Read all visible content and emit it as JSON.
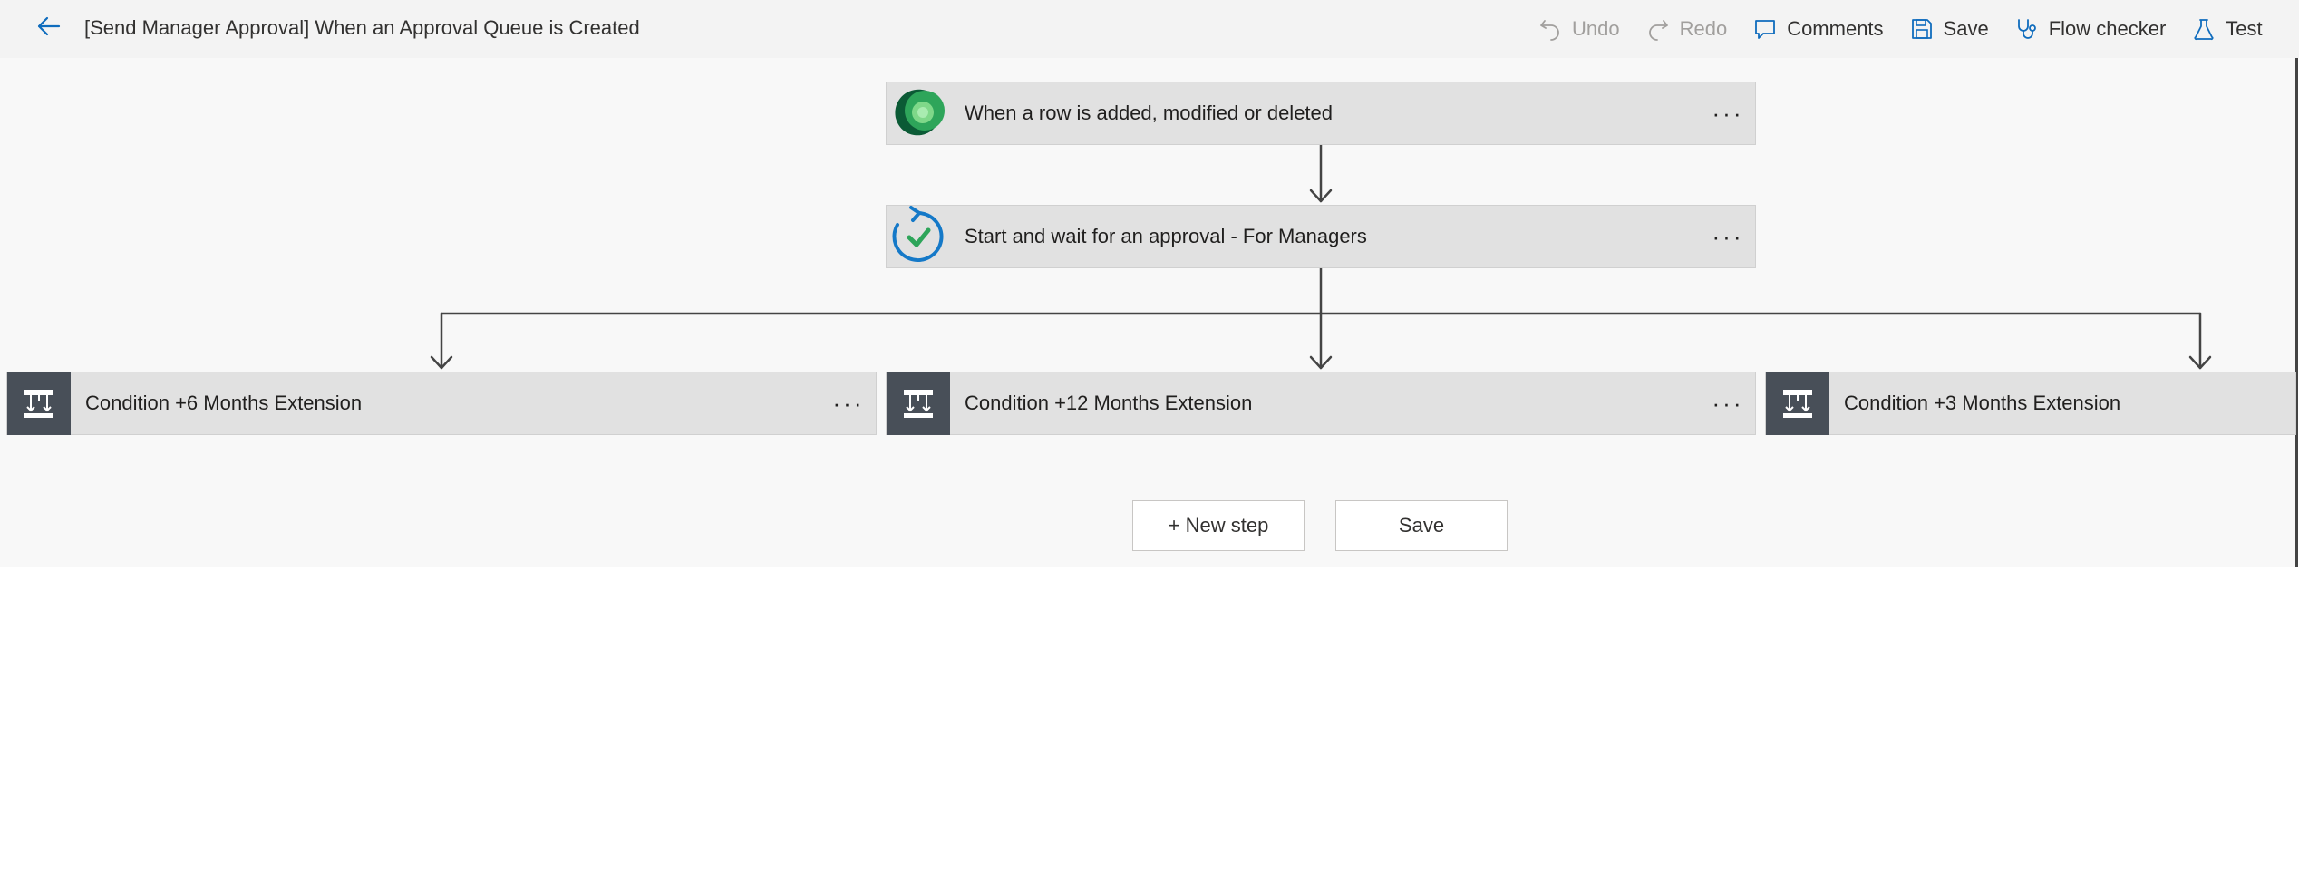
{
  "header": {
    "title": "[Send Manager Approval] When an Approval Queue is Created",
    "back_icon": "arrow-left-icon"
  },
  "toolbar": {
    "undo_label": "Undo",
    "redo_label": "Redo",
    "comments_label": "Comments",
    "save_label": "Save",
    "flow_checker_label": "Flow checker",
    "test_label": "Test"
  },
  "flow": {
    "trigger": {
      "title": "When a row is added, modified or deleted",
      "icon": "dataverse-icon",
      "more": "···"
    },
    "approval": {
      "title": "Start and wait for an approval - For Managers",
      "icon": "approval-icon",
      "more": "···"
    },
    "conditions": [
      {
        "title": "Condition +6 Months Extension",
        "icon": "condition-icon",
        "more": "···"
      },
      {
        "title": "Condition +12 Months Extension",
        "icon": "condition-icon",
        "more": "···"
      },
      {
        "title": "Condition +3 Months Extension",
        "icon": "condition-icon",
        "more": ""
      }
    ]
  },
  "footer": {
    "new_step_label": "+ New step",
    "save_label": "Save"
  },
  "colors": {
    "accent": "#0f6cbd",
    "condition_icon_bg": "#484f58",
    "card_bg": "#e1e1e1",
    "canvas_bg": "#f8f8f8"
  }
}
